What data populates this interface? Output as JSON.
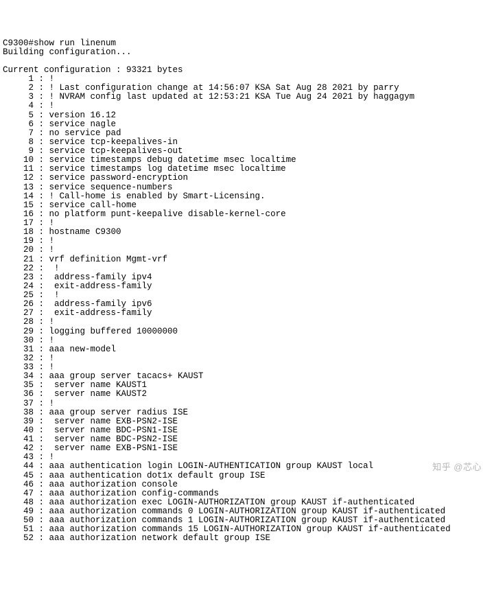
{
  "terminal": {
    "prompt": "C9300#show run linenum",
    "building": "Building configuration...",
    "blank1": "",
    "current": "Current configuration : 93321 bytes",
    "lines": [
      "     1 : !",
      "     2 : ! Last configuration change at 14:56:07 KSA Sat Aug 28 2021 by parry",
      "     3 : ! NVRAM config last updated at 12:53:21 KSA Tue Aug 24 2021 by haggagym",
      "     4 : !",
      "     5 : version 16.12",
      "     6 : service nagle",
      "     7 : no service pad",
      "     8 : service tcp-keepalives-in",
      "     9 : service tcp-keepalives-out",
      "    10 : service timestamps debug datetime msec localtime",
      "    11 : service timestamps log datetime msec localtime",
      "    12 : service password-encryption",
      "    13 : service sequence-numbers",
      "    14 : ! Call-home is enabled by Smart-Licensing.",
      "    15 : service call-home",
      "    16 : no platform punt-keepalive disable-kernel-core",
      "    17 : !",
      "    18 : hostname C9300",
      "    19 : !",
      "    20 : !",
      "    21 : vrf definition Mgmt-vrf",
      "    22 :  !",
      "    23 :  address-family ipv4",
      "    24 :  exit-address-family",
      "    25 :  !",
      "    26 :  address-family ipv6",
      "    27 :  exit-address-family",
      "    28 : !",
      "    29 : logging buffered 10000000",
      "    30 : !",
      "    31 : aaa new-model",
      "    32 : !",
      "    33 : !",
      "    34 : aaa group server tacacs+ KAUST",
      "    35 :  server name KAUST1",
      "    36 :  server name KAUST2",
      "    37 : !",
      "    38 : aaa group server radius ISE",
      "    39 :  server name EXB-PSN2-ISE",
      "    40 :  server name BDC-PSN1-ISE",
      "    41 :  server name BDC-PSN2-ISE",
      "    42 :  server name EXB-PSN1-ISE",
      "    43 : !",
      "    44 : aaa authentication login LOGIN-AUTHENTICATION group KAUST local",
      "    45 : aaa authentication dot1x default group ISE",
      "    46 : aaa authorization console",
      "    47 : aaa authorization config-commands",
      "    48 : aaa authorization exec LOGIN-AUTHORIZATION group KAUST if-authenticated",
      "    49 : aaa authorization commands 0 LOGIN-AUTHORIZATION group KAUST if-authenticated",
      "    50 : aaa authorization commands 1 LOGIN-AUTHORIZATION group KAUST if-authenticated",
      "    51 : aaa authorization commands 15 LOGIN-AUTHORIZATION group KAUST if-authenticated",
      "    52 : aaa authorization network default group ISE"
    ]
  },
  "watermark": "知乎 @芯心"
}
